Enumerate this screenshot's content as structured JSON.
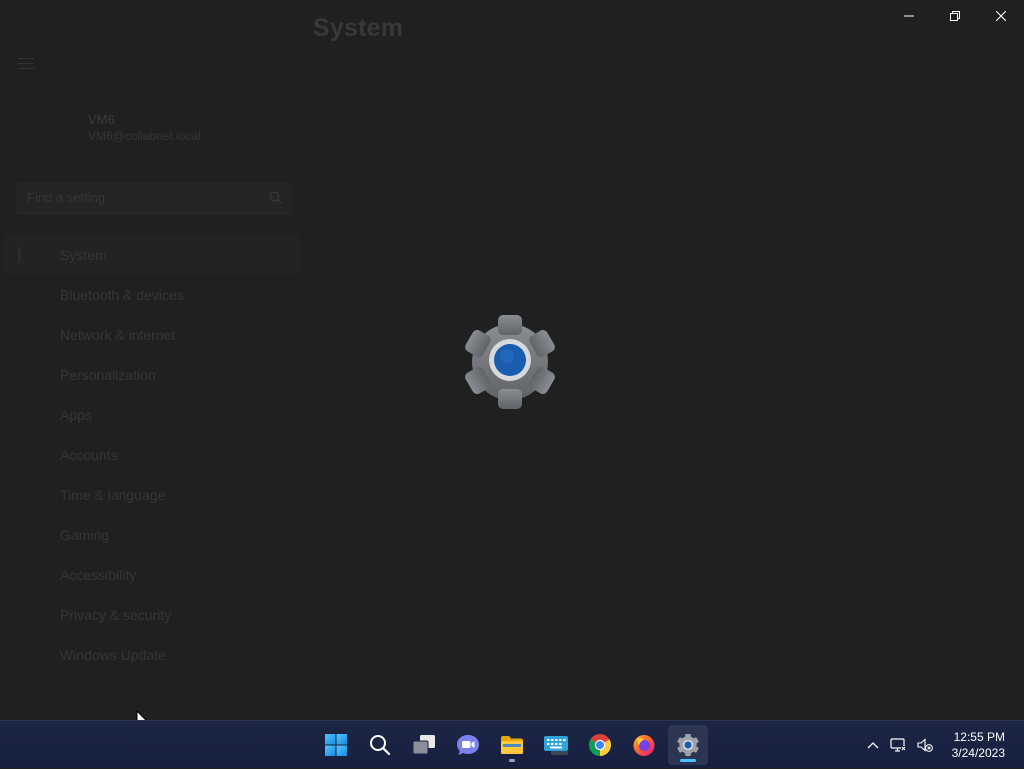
{
  "window": {
    "title": "System",
    "controls": {
      "minimize_icon": "minimize-icon",
      "restore_icon": "restore-icon",
      "close_icon": "close-icon"
    }
  },
  "account": {
    "name": "VM6",
    "email": "VM6@collabnet.local"
  },
  "search": {
    "placeholder": "Find a setting"
  },
  "nav": {
    "items": [
      {
        "label": "System",
        "active": true
      },
      {
        "label": "Bluetooth & devices"
      },
      {
        "label": "Network & internet"
      },
      {
        "label": "Personalization"
      },
      {
        "label": "Apps"
      },
      {
        "label": "Accounts"
      },
      {
        "label": "Time & language"
      },
      {
        "label": "Gaming"
      },
      {
        "label": "Accessibility"
      },
      {
        "label": "Privacy & security"
      },
      {
        "label": "Windows Update"
      }
    ]
  },
  "splash": {
    "icon": "settings-gear-icon"
  },
  "taskbar": {
    "apps": [
      {
        "name": "start",
        "icon": "windows-start-icon"
      },
      {
        "name": "search",
        "icon": "search-icon"
      },
      {
        "name": "task-view",
        "icon": "task-view-icon"
      },
      {
        "name": "chat",
        "icon": "chat-icon"
      },
      {
        "name": "file-explorer",
        "icon": "folder-icon",
        "running": true
      },
      {
        "name": "touch-keyboard",
        "icon": "keyboard-icon"
      },
      {
        "name": "chrome",
        "icon": "chrome-icon"
      },
      {
        "name": "firefox",
        "icon": "firefox-icon"
      },
      {
        "name": "settings",
        "icon": "settings-gear-icon",
        "running": true,
        "active": true
      }
    ],
    "tray": {
      "overflow_icon": "chevron-up-icon",
      "network_icon": "network-icon",
      "volume_icon": "volume-muted-icon"
    },
    "clock": {
      "time": "12:55 PM",
      "date": "3/24/2023"
    }
  },
  "colors": {
    "background": "#202020",
    "taskbar": "#1b2544",
    "accent": "#4cc2ff",
    "gear_center": "#1a5cae"
  }
}
